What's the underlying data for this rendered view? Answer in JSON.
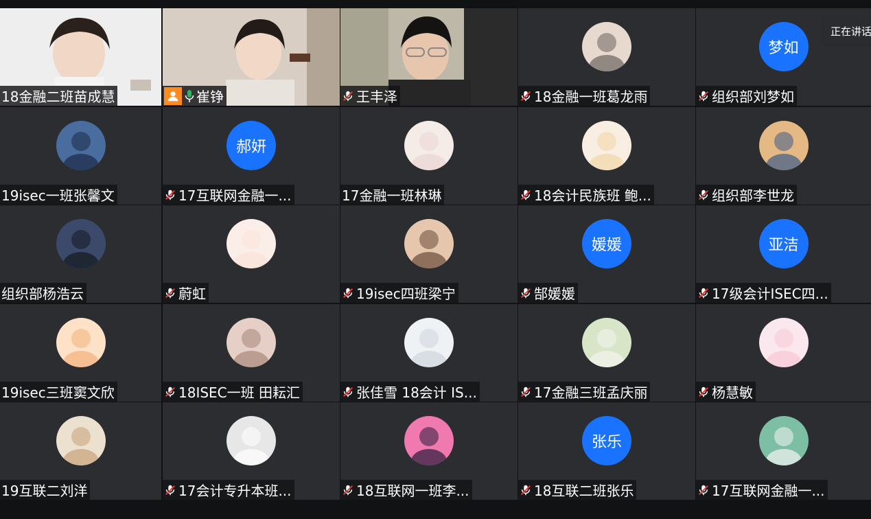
{
  "speaking_indicator": "正在讲话",
  "participants": [
    {
      "name": "18金融二班苗成慧",
      "muted": false,
      "kind": "video",
      "bg": "white"
    },
    {
      "name": "崔铮",
      "muted": false,
      "kind": "video",
      "bg": "room",
      "host": true,
      "mic_on": true
    },
    {
      "name": "王丰泽",
      "muted": true,
      "kind": "video",
      "bg": "curtain"
    },
    {
      "name": "18金融一班葛龙雨",
      "muted": true,
      "kind": "photo",
      "avatar_icon": "girl-portrait-icon",
      "colors": [
        "#6b6560",
        "#e8d9cf"
      ]
    },
    {
      "name": "组织部刘梦如",
      "muted": true,
      "kind": "text",
      "avatar_text": "梦如"
    },
    {
      "name": "19isec一班张馨文",
      "muted": false,
      "kind": "photo",
      "avatar_icon": "dark-portrait-icon",
      "colors": [
        "#1b2a45",
        "#4a6da0"
      ]
    },
    {
      "name": "17互联网金融一...",
      "muted": true,
      "kind": "text",
      "avatar_text": "郝妍"
    },
    {
      "name": "17金融一班林琳",
      "muted": false,
      "kind": "photo",
      "avatar_icon": "doll-portrait-icon",
      "colors": [
        "#e9d6d4",
        "#f5ece8"
      ]
    },
    {
      "name": "18会计民族班 鲍...",
      "muted": true,
      "kind": "photo",
      "avatar_icon": "anime-girl-icon",
      "colors": [
        "#f2d6a8",
        "#f8efe2"
      ]
    },
    {
      "name": "组织部李世龙",
      "muted": true,
      "kind": "photo",
      "avatar_icon": "cartoon-shop-icon",
      "colors": [
        "#3f5c8a",
        "#e4b983"
      ]
    },
    {
      "name": "组织部杨浩云",
      "muted": false,
      "kind": "photo",
      "avatar_icon": "night-portrait-icon",
      "colors": [
        "#141820",
        "#3b4a6a"
      ]
    },
    {
      "name": "蔚虹",
      "muted": true,
      "kind": "photo",
      "avatar_icon": "cute-face-icon",
      "colors": [
        "#fbe3d8",
        "#fbeee8"
      ]
    },
    {
      "name": "19isec四班梁宁",
      "muted": true,
      "kind": "photo",
      "avatar_icon": "girl-smile-icon",
      "colors": [
        "#6a4c3a",
        "#e6c7ae"
      ]
    },
    {
      "name": "郜媛媛",
      "muted": true,
      "kind": "text",
      "avatar_text": "媛媛"
    },
    {
      "name": "17级会计ISEC四...",
      "muted": true,
      "kind": "text",
      "avatar_text": "亚洁"
    },
    {
      "name": "19isec三班窦文欣",
      "muted": false,
      "kind": "photo",
      "avatar_icon": "girl-bangs-icon",
      "colors": [
        "#f3b07a",
        "#fde2c8"
      ]
    },
    {
      "name": "18ISEC一班 田耘汇",
      "muted": true,
      "kind": "photo",
      "avatar_icon": "hand-face-icon",
      "colors": [
        "#a9877a",
        "#e5cfc6"
      ]
    },
    {
      "name": "张佳雪 18会计 IS...",
      "muted": true,
      "kind": "photo",
      "avatar_icon": "image-placeholder-icon",
      "colors": [
        "#cfd6dd",
        "#eef2f5"
      ]
    },
    {
      "name": "17金融三班孟庆丽",
      "muted": true,
      "kind": "photo",
      "avatar_icon": "panda-icon",
      "colors": [
        "#f4f4f0",
        "#d8e6c7"
      ]
    },
    {
      "name": "杨慧敏",
      "muted": true,
      "kind": "photo",
      "avatar_icon": "pink-glasses-icon",
      "colors": [
        "#f7c8d6",
        "#fbe8ee"
      ]
    },
    {
      "name": "19互联二刘洋",
      "muted": false,
      "kind": "photo",
      "avatar_icon": "cat-sign-icon",
      "colors": [
        "#c9a27a",
        "#ece0cf"
      ]
    },
    {
      "name": "17会计专升本班...",
      "muted": true,
      "kind": "photo",
      "avatar_icon": "basketball-player-icon",
      "colors": [
        "#ffffff",
        "#e7e7e7"
      ]
    },
    {
      "name": "18互联网一班李...",
      "muted": true,
      "kind": "photo",
      "avatar_icon": "neon-girl-icon",
      "colors": [
        "#2a1b3d",
        "#f07ab0"
      ]
    },
    {
      "name": "18互联二班张乐",
      "muted": true,
      "kind": "text",
      "avatar_text": "张乐"
    },
    {
      "name": "17互联网金融一...",
      "muted": true,
      "kind": "photo",
      "avatar_icon": "sketch-man-icon",
      "colors": [
        "#f3f3f3",
        "#7cbfa4"
      ]
    }
  ]
}
